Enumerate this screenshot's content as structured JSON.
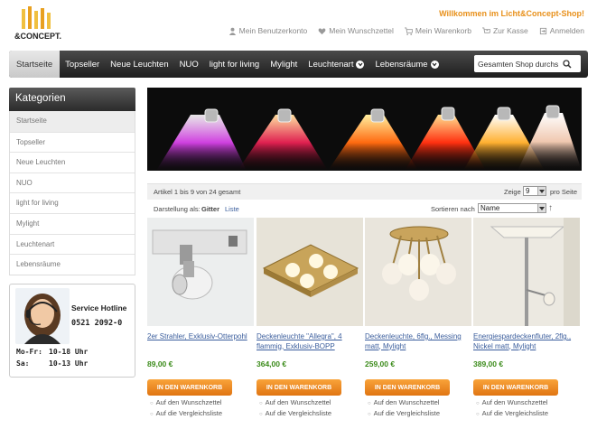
{
  "header": {
    "logo_text": "LICHT & CONCEPT",
    "welcome": "Willkommen im Licht&Concept-Shop!",
    "links": [
      {
        "icon": "user-icon",
        "label": "Mein Benutzerkonto"
      },
      {
        "icon": "heart-icon",
        "label": "Mein Wunschzettel"
      },
      {
        "icon": "cart-icon",
        "label": "Mein Warenkorb"
      },
      {
        "icon": "checkout-icon",
        "label": "Zur Kasse"
      },
      {
        "icon": "login-icon",
        "label": "Anmelden"
      }
    ]
  },
  "nav": {
    "items": [
      {
        "label": "Startseite"
      },
      {
        "label": "Topseller"
      },
      {
        "label": "Neue Leuchten"
      },
      {
        "label": "NUO"
      },
      {
        "label": "light for living"
      },
      {
        "label": "Mylight"
      },
      {
        "label": "Leuchtenart"
      },
      {
        "label": "Lebensräume"
      }
    ],
    "search_value": "Gesamten Shop durchs"
  },
  "sidebar": {
    "title": "Kategorien",
    "items": [
      {
        "label": "Startseite"
      },
      {
        "label": "Topseller"
      },
      {
        "label": "Neue Leuchten"
      },
      {
        "label": "NUO"
      },
      {
        "label": "light for living"
      },
      {
        "label": "Mylight"
      },
      {
        "label": "Leuchtenart"
      },
      {
        "label": "Lebensräume"
      }
    ]
  },
  "hotline": {
    "title": "Service Hotline",
    "phone": "0521 2092-0",
    "hours": [
      {
        "days": "Mo-Fr:",
        "time": "10-18 Uhr"
      },
      {
        "days": "Sa:",
        "time": "10-13 Uhr"
      }
    ]
  },
  "toolbar": {
    "count": "Artikel 1 bis 9 von 24 gesamt",
    "show_label": "Zeige",
    "show_value": "9",
    "per_page": "pro Seite",
    "view_label": "Darstellung als:",
    "view_grid": "Gitter",
    "view_list": "Liste",
    "sort_label": "Sortieren nach",
    "sort_value": "Name"
  },
  "products": [
    {
      "name": "2er Strahler, Exklusiv-Otterpohl",
      "price": "89,00 €"
    },
    {
      "name": "Deckenleuchte \"Allegra\", 4 flammig, Exklusiv-BOPP",
      "price": "364,00 €"
    },
    {
      "name": "Deckenleuchte, 6flg., Messing matt, Mylight",
      "price": "259,00 €"
    },
    {
      "name": "Energiespardeckenfluter, 2flg., Nickel matt, Mylight",
      "price": "389,00 €"
    }
  ],
  "product_actions": {
    "cart": "IN DEN WARENKORB",
    "wishlist": "Auf den Wunschzettel",
    "compare": "Auf die Vergleichsliste"
  },
  "colors": {
    "accent_orange": "#e8901a",
    "price_green": "#3b8b1a",
    "link_blue": "#3a5d9c",
    "nav_dark": "#2b2b2b"
  }
}
